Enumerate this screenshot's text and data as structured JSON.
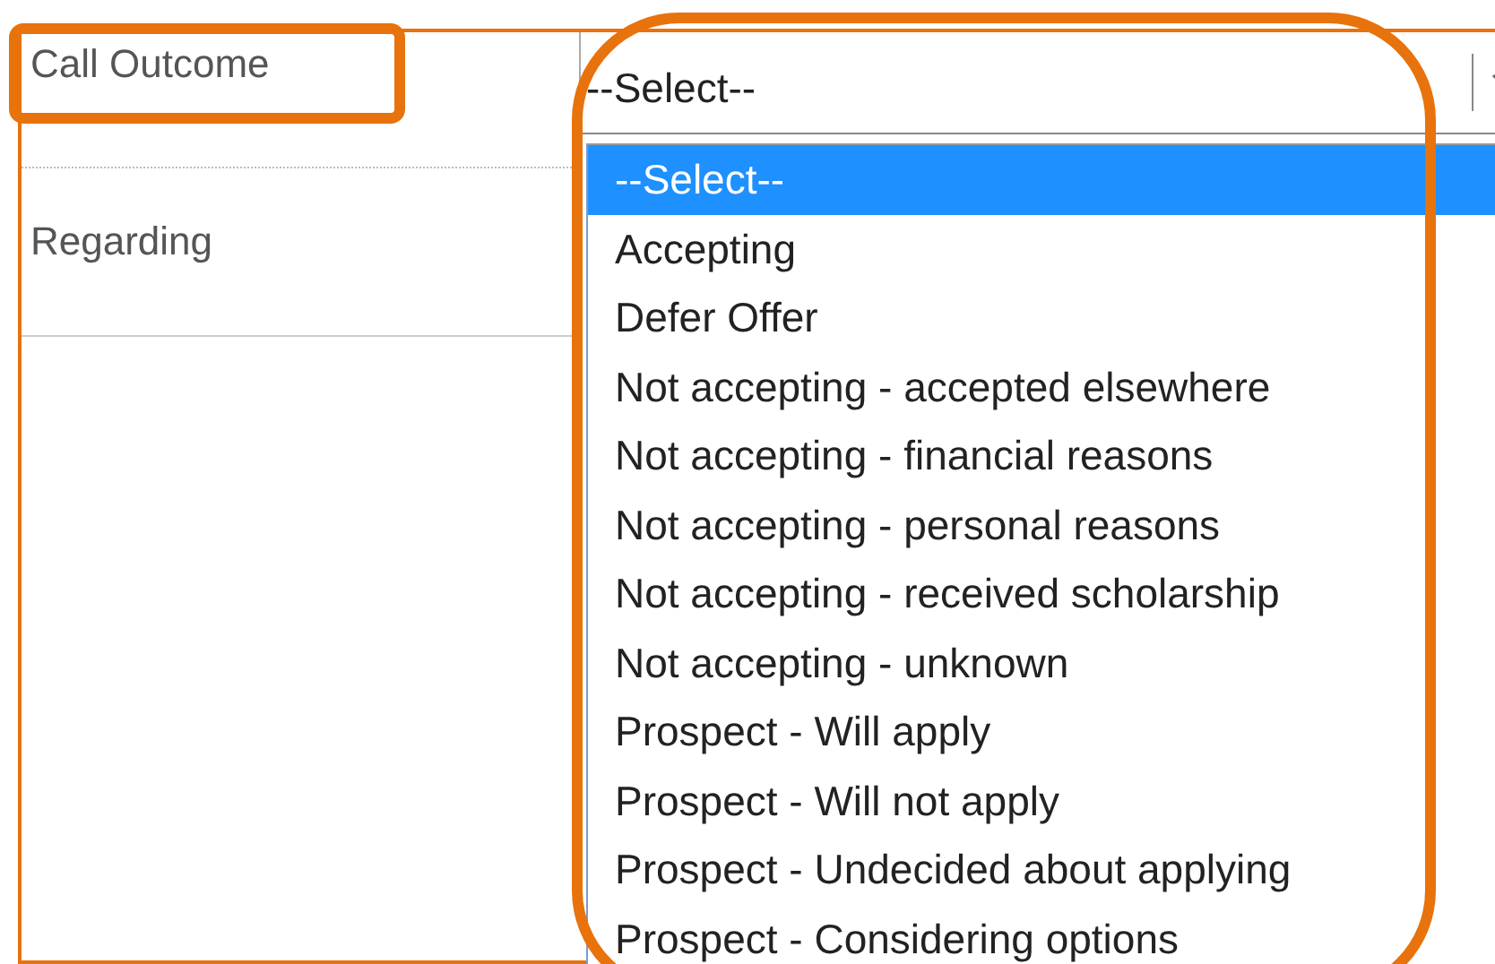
{
  "fields": [
    {
      "label": "Call Outcome",
      "value": "--Select--",
      "highlighted": true
    },
    {
      "label": "Regarding"
    }
  ],
  "dropdown": {
    "highlighted": true,
    "options": [
      {
        "label": "--Select--",
        "selected": true
      },
      {
        "label": "Accepting",
        "selected": false
      },
      {
        "label": "Defer Offer",
        "selected": false
      },
      {
        "label": "Not accepting - accepted elsewhere",
        "selected": false
      },
      {
        "label": "Not accepting - financial reasons",
        "selected": false
      },
      {
        "label": "Not accepting - personal reasons",
        "selected": false
      },
      {
        "label": "Not accepting - received scholarship",
        "selected": false
      },
      {
        "label": "Not accepting - unknown",
        "selected": false
      },
      {
        "label": "Prospect - Will apply",
        "selected": false
      },
      {
        "label": "Prospect - Will not apply",
        "selected": false
      },
      {
        "label": "Prospect - Undecided about applying",
        "selected": false
      },
      {
        "label": "Prospect - Considering options",
        "selected": false
      }
    ]
  }
}
